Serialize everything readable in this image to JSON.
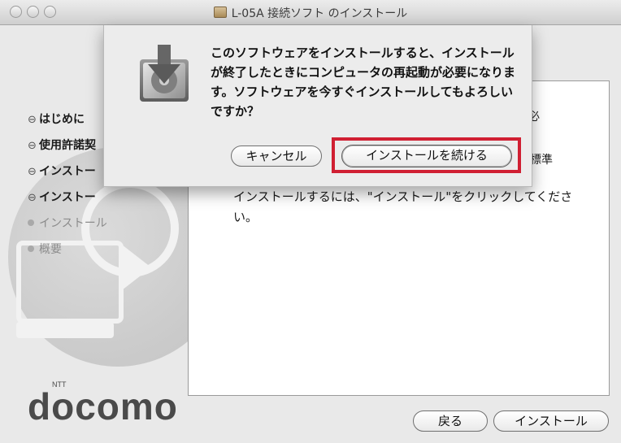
{
  "window": {
    "title": "L-05A 接続ソフト のインストール"
  },
  "sidebar": {
    "steps": [
      {
        "bullet": "⊖",
        "label": "はじめに"
      },
      {
        "bullet": "⊖",
        "label": "使用許諾契"
      },
      {
        "bullet": "⊖",
        "label": "インストー"
      },
      {
        "bullet": "⊖",
        "label": "インストー"
      },
      {
        "bullet": "",
        "label": "インストール"
      },
      {
        "bullet": "",
        "label": "概要"
      }
    ],
    "brand": "docomo",
    "brand_small": "NTT"
  },
  "main": {
    "right_fragment_1": "必",
    "right_fragment_2": "標準",
    "body_text": "インストールするには、\"インストール\"をクリックしてください。",
    "back_label": "戻る",
    "install_label": "インストール"
  },
  "dialog": {
    "message": "このソフトウェアをインストールすると、インストールが終了したときにコンピュータの再起動が必要になります。ソフトウェアを今すぐインストールしてもよろしいですか？",
    "cancel_label": "キャンセル",
    "continue_label": "インストールを続ける",
    "highlight_color": "#d01f32"
  }
}
